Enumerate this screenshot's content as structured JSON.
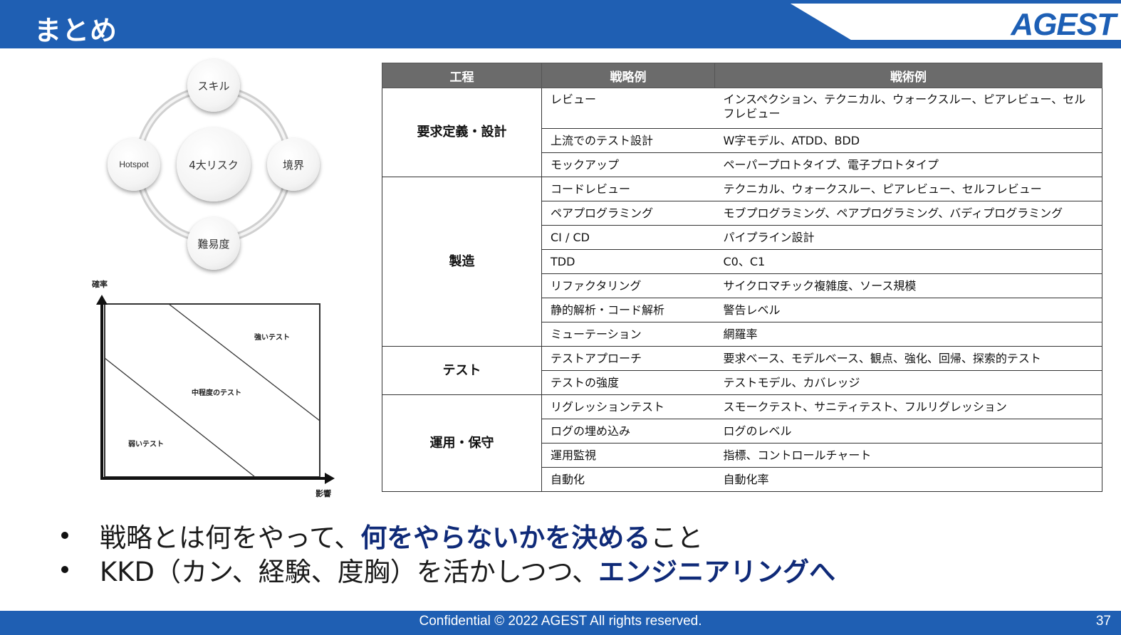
{
  "header": {
    "title": "まとめ",
    "logo": "AGEST"
  },
  "risk_diagram": {
    "center": "4大リスク",
    "top": "スキル",
    "left": "Hotspot",
    "right": "境界",
    "bottom": "難易度"
  },
  "matrix": {
    "y_axis": "確率",
    "x_axis": "影響",
    "strong": "強いテスト",
    "medium": "中程度のテスト",
    "weak": "弱いテスト"
  },
  "table": {
    "headers": [
      "工程",
      "戦略例",
      "戦術例"
    ],
    "groups": [
      {
        "process": "要求定義・設計",
        "rows": [
          {
            "strategy": "レビュー",
            "tactics": "インスペクション、テクニカル、ウォークスルー、ピアレビュー、セルフレビュー"
          },
          {
            "strategy": "上流でのテスト設計",
            "tactics": "W字モデル、ATDD、BDD"
          },
          {
            "strategy": "モックアップ",
            "tactics": "ペーパープロトタイプ、電子プロトタイプ"
          }
        ]
      },
      {
        "process": "製造",
        "rows": [
          {
            "strategy": "コードレビュー",
            "tactics": "テクニカル、ウォークスルー、ピアレビュー、セルフレビュー"
          },
          {
            "strategy": "ペアプログラミング",
            "tactics": "モブプログラミング、ペアプログラミング、バディプログラミング"
          },
          {
            "strategy": "CI / CD",
            "tactics": "パイプライン設計"
          },
          {
            "strategy": "TDD",
            "tactics": "C0、C1"
          },
          {
            "strategy": "リファクタリング",
            "tactics": "サイクロマチック複雑度、ソース規模"
          },
          {
            "strategy": "静的解析・コード解析",
            "tactics": "警告レベル"
          },
          {
            "strategy": "ミューテーション",
            "tactics": "網羅率"
          }
        ]
      },
      {
        "process": "テスト",
        "rows": [
          {
            "strategy": "テストアプローチ",
            "tactics": "要求ベース、モデルベース、観点、強化、回帰、探索的テスト"
          },
          {
            "strategy": "テストの強度",
            "tactics": "テストモデル、カバレッジ"
          }
        ]
      },
      {
        "process": "運用・保守",
        "rows": [
          {
            "strategy": "リグレッションテスト",
            "tactics": "スモークテスト、サニティテスト、フルリグレッション"
          },
          {
            "strategy": "ログの埋め込み",
            "tactics": "ログのレベル"
          },
          {
            "strategy": "運用監視",
            "tactics": "指標、コントロールチャート"
          },
          {
            "strategy": "自動化",
            "tactics": "自動化率"
          }
        ]
      }
    ]
  },
  "bullets": [
    {
      "before": "戦略とは何をやって、",
      "emphasis": "何をやらないかを決める",
      "after": "こと"
    },
    {
      "before": "KKD（カン、経験、度胸）を活かしつつ、",
      "emphasis": "エンジニアリングへ",
      "after": ""
    }
  ],
  "footer": {
    "copyright": "Confidential © 2022 AGEST All rights reserved.",
    "page": "37"
  },
  "colors": {
    "brand_blue": "#1f5fb3",
    "emphasis_navy": "#0f2a78",
    "table_header": "#6b6b6b"
  }
}
